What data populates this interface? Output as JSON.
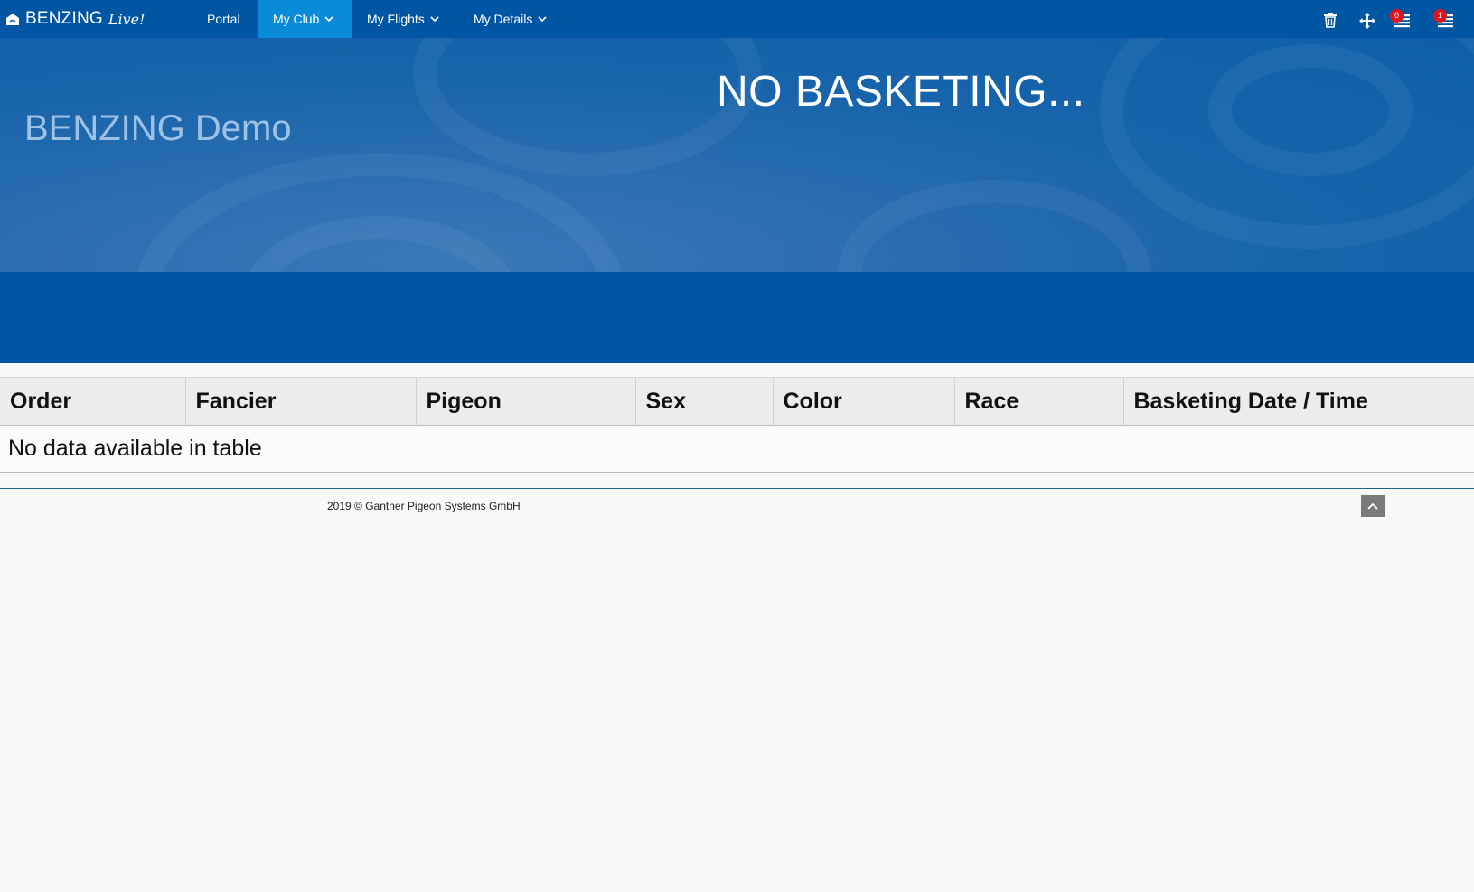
{
  "brand": {
    "name": "BENZING",
    "suffix": "Live!"
  },
  "nav": {
    "items": [
      {
        "label": "Portal",
        "active": false,
        "dropdown": false
      },
      {
        "label": "My Club",
        "active": true,
        "dropdown": true
      },
      {
        "label": "My Flights",
        "active": false,
        "dropdown": true
      },
      {
        "label": "My Details",
        "active": false,
        "dropdown": true
      }
    ],
    "icons": [
      {
        "name": "trash-icon",
        "badge": null
      },
      {
        "name": "move-icon",
        "badge": null
      },
      {
        "name": "list-icon",
        "badge": "0"
      },
      {
        "name": "list-icon",
        "badge": "1"
      }
    ]
  },
  "hero": {
    "club_name": "BENZING Demo",
    "message": "NO BASKETING..."
  },
  "table": {
    "headers": [
      "Order",
      "Fancier",
      "Pigeon",
      "Sex",
      "Color",
      "Race",
      "Basketing Date / Time"
    ],
    "empty_text": "No data available in table"
  },
  "footer": {
    "copyright": "2019 © Gantner Pigeon Systems GmbH"
  },
  "colors": {
    "nav_bg": "#0156a4",
    "nav_active": "#0a8bd8",
    "badge": "#e4131b"
  }
}
